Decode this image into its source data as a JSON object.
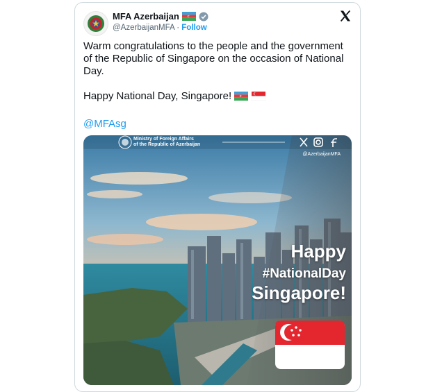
{
  "post": {
    "author_name": "MFA Azerbaijan",
    "handle": "@AzerbaijanMFA",
    "separator": "·",
    "follow_label": "Follow",
    "text_line_1": "Warm congratulations to the people and the government of the Republic of Singapore on the occasion of National Day.",
    "text_line_2": "Happy National Day, Singapore!",
    "mention": "@MFAsg"
  },
  "image": {
    "ministry_line_1": "Ministry of Foreign Affairs",
    "ministry_line_2": "of the Republic of Azerbaijan",
    "image_handle": "@AzerbaijanMFA",
    "headline_1": "Happy",
    "headline_2": "#NationalDay",
    "headline_3": "Singapore!",
    "social_icons": [
      "x-icon",
      "instagram-icon",
      "facebook-icon"
    ]
  },
  "colors": {
    "link": "#1d9bf0",
    "text": "#0f1419",
    "secondary": "#536471",
    "border": "#cfd9de",
    "singapore_red": "#e4262f",
    "az_blue": "#3f9fd6",
    "az_red": "#e23b3b",
    "az_green": "#3aa655"
  }
}
